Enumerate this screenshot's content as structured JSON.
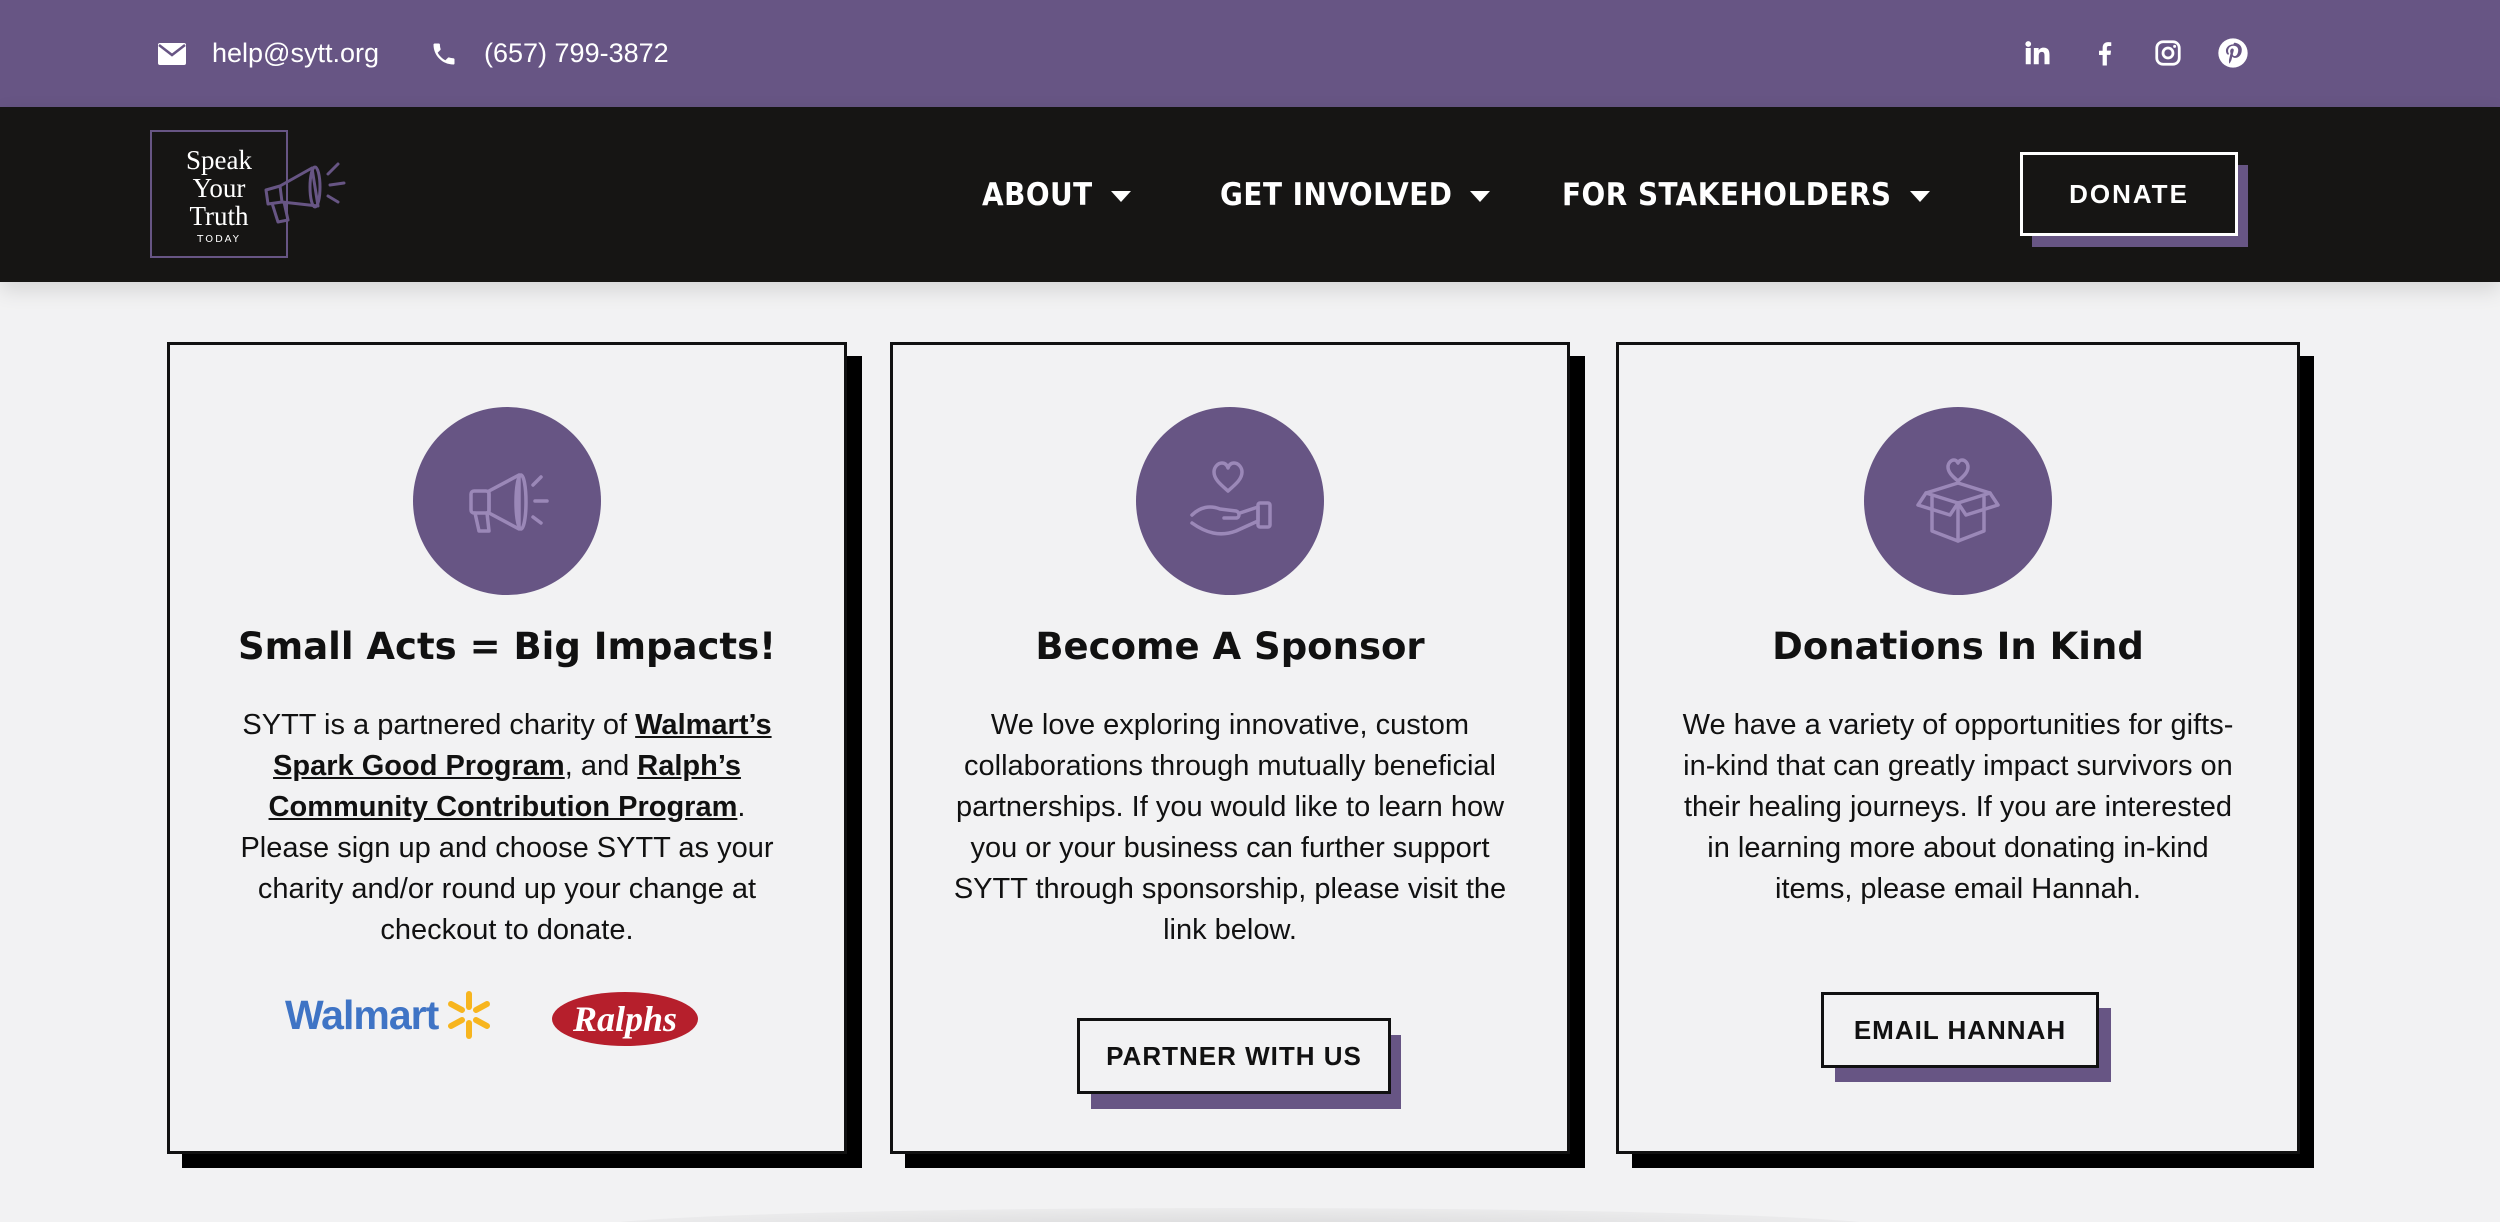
{
  "topbar": {
    "email": "help@sytt.org",
    "phone": "(657) 799-3872",
    "social_icons": [
      "linkedin-icon",
      "facebook-icon",
      "instagram-icon",
      "pinterest-icon"
    ]
  },
  "logo": {
    "line1": "Speak",
    "line2": "Your",
    "line3": "Truth",
    "line4": "TODAY"
  },
  "nav": {
    "items": [
      {
        "label": "ABOUT"
      },
      {
        "label": "GET INVOLVED"
      },
      {
        "label": "FOR STAKEHOLDERS"
      }
    ],
    "donate_label": "DONATE"
  },
  "cards": [
    {
      "icon": "megaphone-icon",
      "title": "Small Acts = Big Impacts!",
      "body_prefix": "SYTT is a partnered charity of ",
      "link1": "Walmart’s Spark Good Program",
      "body_mid": ", and ",
      "link2": "Ralph’s Community Contribution Program",
      "body_suffix": ". Please sign up and choose SYTT as your charity and/or round up your change at checkout to donate.",
      "walmart_logo": "Walmart",
      "ralphs_logo": "Ralphs"
    },
    {
      "icon": "heart-hand-icon",
      "title": "Become A Sponsor",
      "body": "We love exploring innovative, custom collaborations through mutually beneficial partnerships. If you would like to learn how you or your business can further support SYTT through sponsorship, please visit the link below.",
      "button": "PARTNER WITH US"
    },
    {
      "icon": "gift-box-icon",
      "title": "Donations In Kind",
      "body": "We have a variety of opportunities for gifts-in-kind that can greatly impact survivors on their healing journeys. If you are interested in learning more about donating in-kind items, please email Hannah.",
      "button": "EMAIL HANNAH"
    }
  ],
  "colors": {
    "brand_purple": "#675584",
    "nav_background": "#161514",
    "page_background": "#f2f2f3"
  }
}
